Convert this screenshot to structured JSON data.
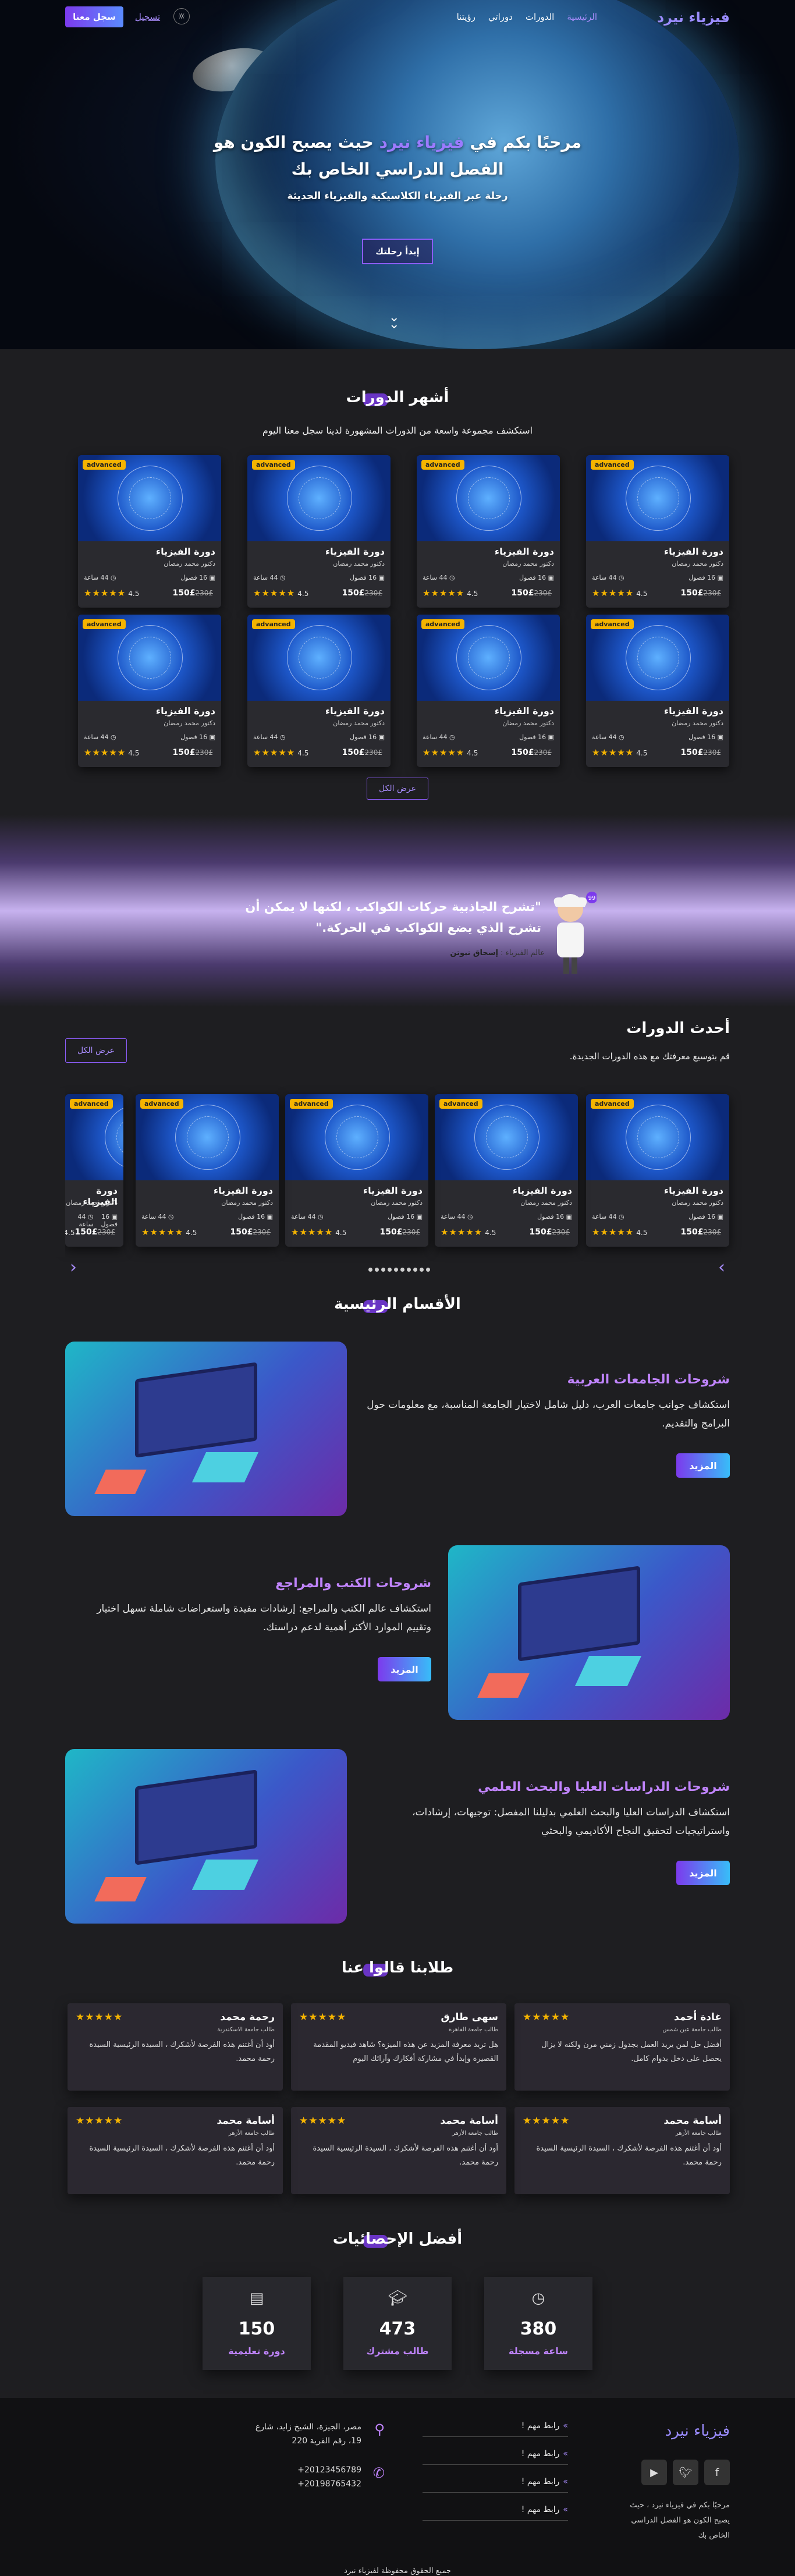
{
  "nav": {
    "brand": "فيزياء نيرد",
    "links": [
      "الرئيسية",
      "الدورات",
      "دوراتي",
      "رؤيتنا"
    ],
    "theme_icon": "sun-icon",
    "login": "تسجيل",
    "signup": "سجل معنا"
  },
  "hero": {
    "title_part1": "مرحبًا بكم في",
    "title_highlight": "فيزياء نيرد",
    "title_part2": "حيث يصبح الكون هو الفصل الدراسي الخاص بك",
    "subtitle": "رحلة عبر الفيزياء الكلاسيكية والفيزياء الحديثة",
    "cta": "إبدأ رحلتك"
  },
  "popular": {
    "title": "أشهر الدورات",
    "subtitle": "استكشف مجموعة واسعة من الدورات المشهورة لدينا سجل معنا اليوم",
    "show_all": "عرض الكل"
  },
  "course": {
    "badge": "advanced",
    "title": "دورة الفيزياء",
    "instructor": "دكتور محمد رمضان",
    "lessons": "16 فصول",
    "hours": "44 ساعة",
    "price": "150£",
    "old_price": "230£",
    "rating": "4.5",
    "stars": "★★★★★"
  },
  "quote": {
    "text": "\"تشرح الجاذبية حركات الكواكب ، لكنها لا يمكن أن تشرح الذي يضع الكواكب في الحركة.\"",
    "author_prefix": "عالم الفيزياء :",
    "author": "إسحاق نيوتن"
  },
  "latest": {
    "title": "أحدث الدورات",
    "subtitle": "قم بتوسيع معرفتك مع هذه الدورات الجديدة.",
    "show_all": "عرض الكل"
  },
  "sections": {
    "title": "الأقسام الرئيسية",
    "items": [
      {
        "title": "شروحات الجامعات العربية",
        "text": "استكشاف جوانب جامعات العرب، دليل شامل لاختيار الجامعة المناسبة، مع معلومات حول البرامج والتقديم.",
        "button": "المزيد"
      },
      {
        "title": "شروحات الكتب والمراجع",
        "text": "استكشاف عالم الكتب والمراجع: إرشادات مفيدة واستعراضات شاملة تسهل اختيار وتقييم الموارد الأكثر أهمية لدعم دراستك.",
        "button": "المزيد"
      },
      {
        "title": "شروحات الدراسات العليا والبحث العلمي",
        "text": "استكشاف الدراسات العليا والبحث العلمي بدليلنا المفصل: توجيهات، إرشادات، واستراتيجيات لتحقيق النجاح الأكاديمي والبحثي",
        "button": "المزيد"
      }
    ]
  },
  "testimonials": {
    "title": "طلابنا قالوا عنا",
    "stars": "★★★★★",
    "items": [
      {
        "name": "غادة أحمد",
        "role": "طالب جامعة عين شمس",
        "text": "أفضل حل لمن يريد العمل بجدول زمني مرن ولكنه لا يزال يحصل على دخل بدوام كامل."
      },
      {
        "name": "سهى طارق",
        "role": "طالب جامعة القاهرة",
        "text": "هل تريد معرفة المزيد عن هذه الميزة؟ شاهد فيديو المقدمة القصيرة وإبدأ في مشاركة أفكارك وآرائك اليوم"
      },
      {
        "name": "رحمة محمد",
        "role": "طالب جامعة الاسكندرية",
        "text": "أود أن أغتنم هذه الفرصة لأشكرك ، السيدة الرئيسية السيدة رحمة محمد."
      },
      {
        "name": "أسامة محمد",
        "role": "طالب جامعة الأزهر",
        "text": "أود أن أغتنم هذه الفرصة لأشكرك ، السيدة الرئيسية السيدة رحمة محمد."
      },
      {
        "name": "أسامة محمد",
        "role": "طالب جامعة الأزهر",
        "text": "أود أن أغتنم هذه الفرصة لأشكرك ، السيدة الرئيسية السيدة رحمة محمد."
      },
      {
        "name": "أسامة محمد",
        "role": "طالب جامعة الأزهر",
        "text": "أود أن أغتنم هذه الفرصة لأشكرك ، السيدة الرئيسية السيدة رحمة محمد."
      }
    ]
  },
  "stats": {
    "title": "أفضل الإحصائيات",
    "items": [
      {
        "icon": "clock-icon",
        "value": "380",
        "label": "ساعة مسجلة"
      },
      {
        "icon": "graduation-cap-icon",
        "value": "473",
        "label": "طالب مشترك"
      },
      {
        "icon": "book-icon",
        "value": "150",
        "label": "دورة تعليمية"
      }
    ]
  },
  "footer": {
    "brand": "فيزياء نيرد",
    "social": [
      "facebook-icon",
      "twitter-icon",
      "youtube-icon"
    ],
    "description": "مرحبًا بكم في فيزياء نيرد ، حيث يصبح الكون هو الفصل الدراسي الخاص بك",
    "links": [
      "رابط مهم !",
      "رابط مهم !",
      "رابط مهم !",
      "رابط مهم !"
    ],
    "address": "مصر، الجيزة، الشيخ زايد، شارع 19، رقم القرية 220",
    "phones": "20123456789+ 20198765432+",
    "copyright": "جميع الحقوق محفوظة لفيزياء نيرد"
  },
  "colors": {
    "accent": "#7c3aed",
    "brand": "#9b8cff",
    "star": "#f5b400"
  }
}
